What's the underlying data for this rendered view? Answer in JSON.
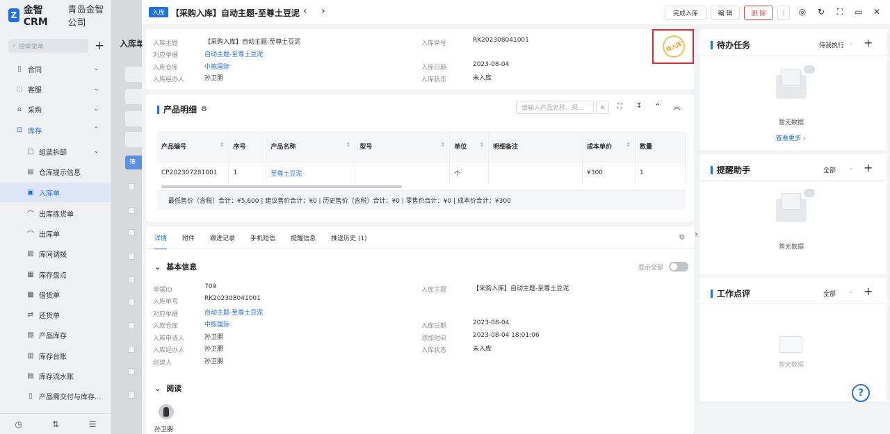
{
  "app": {
    "logo_letter": "Z",
    "name": "金智CRM",
    "company": "青岛金智公司"
  },
  "sidebar": {
    "search_placeholder": "搜索菜单",
    "add_icon": "+",
    "items": [
      {
        "label": "合同",
        "icon": "contract-icon",
        "glyph": "▯",
        "level": "top",
        "chevron": "⌄"
      },
      {
        "label": "客服",
        "icon": "service-icon",
        "glyph": "◌",
        "level": "top",
        "chevron": "⌄"
      },
      {
        "label": "采购",
        "icon": "purchase-icon",
        "glyph": "⌂",
        "level": "top",
        "chevron": "⌄"
      },
      {
        "label": "库存",
        "icon": "inventory-icon",
        "glyph": "⊡",
        "level": "top",
        "chevron": "⌃",
        "open": true
      },
      {
        "label": "组装拆卸",
        "icon": "assembly-icon",
        "glyph": "▢",
        "level": "sub",
        "chevron": "⌄"
      },
      {
        "label": "仓库提示信息",
        "icon": "warehouse-tip-icon",
        "glyph": "▤",
        "level": "sub"
      },
      {
        "label": "入库单",
        "icon": "stock-in-icon",
        "glyph": "▣",
        "level": "sub",
        "active": true
      },
      {
        "label": "出库拣货单",
        "icon": "pick-icon",
        "glyph": "⌒",
        "level": "sub"
      },
      {
        "label": "出库单",
        "icon": "stock-out-icon",
        "glyph": "⌒",
        "level": "sub"
      },
      {
        "label": "库间调拨",
        "icon": "transfer-icon",
        "glyph": "▨",
        "level": "sub"
      },
      {
        "label": "库存盘点",
        "icon": "stocktake-icon",
        "glyph": "▦",
        "level": "sub"
      },
      {
        "label": "借货单",
        "icon": "borrow-icon",
        "glyph": "▩",
        "level": "sub"
      },
      {
        "label": "还货单",
        "icon": "return-icon",
        "glyph": "⇄",
        "level": "sub"
      },
      {
        "label": "产品库存",
        "icon": "product-stock-icon",
        "glyph": "▧",
        "level": "sub"
      },
      {
        "label": "库存台账",
        "icon": "ledger-icon",
        "glyph": "▥",
        "level": "sub"
      },
      {
        "label": "库存流水账",
        "icon": "flow-icon",
        "glyph": "▤",
        "level": "sub"
      },
      {
        "label": "产品需交付与库存...",
        "icon": "delivery-icon",
        "glyph": "▯",
        "level": "sub"
      }
    ],
    "bottom_icons": [
      "history-icon",
      "filter-icon",
      "collapse-icon"
    ],
    "bottom_glyphs": [
      "◷",
      "⇅",
      "☰"
    ]
  },
  "background_list": {
    "title": "入库单",
    "button_label": "筛"
  },
  "header": {
    "tag": "入库",
    "title": "【采购入库】自动主题-至尊土豆泥",
    "prev": "‹",
    "next": "›",
    "buttons": {
      "complete": "完成入库",
      "edit": "编 辑",
      "delete": "删 除",
      "more": "⋮"
    },
    "icons": [
      "target-icon",
      "refresh-icon",
      "fullscreen-icon",
      "minimize-icon",
      "close-icon"
    ],
    "icon_glyphs": [
      "◎",
      "↻",
      "⛶",
      "▭",
      "✕"
    ]
  },
  "summary": {
    "fields": [
      {
        "key": "入库主题",
        "value": "【采购入库】自动主题-至尊土豆泥",
        "link": false
      },
      {
        "key": "对应单据",
        "value": "自动主题-至尊土豆泥",
        "link": true
      },
      {
        "key": "入库仓库",
        "value": "中栋国际",
        "link": true
      },
      {
        "key": "入库经办人",
        "value": "孙卫朋",
        "link": false
      }
    ],
    "fields_right": [
      {
        "key": "入库单号",
        "value": "RK202308041001"
      },
      {
        "key": "入库日期",
        "value": "2023-08-04"
      },
      {
        "key": "入库状态",
        "value": "未入库"
      }
    ],
    "stamp": "待入库"
  },
  "products": {
    "title": "产品明细",
    "search_placeholder": "请输入产品名称、规...",
    "columns": [
      "产品编号",
      "序号",
      "产品名称",
      "型号",
      "单位",
      "明细备注",
      "成本单价",
      "数量"
    ],
    "rows": [
      [
        "CP202307281001",
        "1",
        "至尊土豆泥",
        "",
        "个",
        "",
        "¥300",
        "1"
      ]
    ],
    "totals": "最低售价（含税）合计：¥5,600 | 建议售价合计：¥0 | 历史售价（含税）合计：¥0 | 零售价合计：¥0 | 成本价合计：¥300"
  },
  "detail_tabs": [
    "详情",
    "附件",
    "跟进记录",
    "手机短信",
    "提醒信息",
    "推送历史 (1)"
  ],
  "basic_info": {
    "title": "基本信息",
    "show_all": "显示全部",
    "left": [
      {
        "key": "单据ID",
        "value": "709",
        "link": false
      },
      {
        "key": "入库单号",
        "value": "RK202308041001",
        "link": false
      },
      {
        "key": "对应单据",
        "value": "自动主题-至尊土豆泥",
        "link": true
      },
      {
        "key": "入库仓库",
        "value": "中栋国际",
        "link": true
      },
      {
        "key": "入库申请人",
        "value": "孙卫朋",
        "link": false
      },
      {
        "key": "入库经办人",
        "value": "孙卫朋",
        "link": false
      },
      {
        "key": "创建人",
        "value": "孙卫朋",
        "link": false
      }
    ],
    "right": [
      {
        "key": "入库主题",
        "value": "【采购入库】自动主题-至尊土豆泥"
      },
      {
        "key": "入库日期",
        "value": "2023-08-04"
      },
      {
        "key": "添加时间",
        "value": "2023-08-04 18:01:06"
      },
      {
        "key": "入库状态",
        "value": "未入库"
      }
    ]
  },
  "reading": {
    "title": "阅读",
    "reader": "孙卫朋"
  },
  "right_panel": {
    "todo": {
      "title": "待办任务",
      "filter": "待我执行",
      "empty": "暂无数据",
      "more": "查看更多 ›"
    },
    "reminder": {
      "title": "提醒助手",
      "filter": "全部",
      "empty": "暂无数据"
    },
    "review": {
      "title": "工作点评",
      "filter": "全部",
      "empty": "暂无数据"
    }
  },
  "help": "?"
}
